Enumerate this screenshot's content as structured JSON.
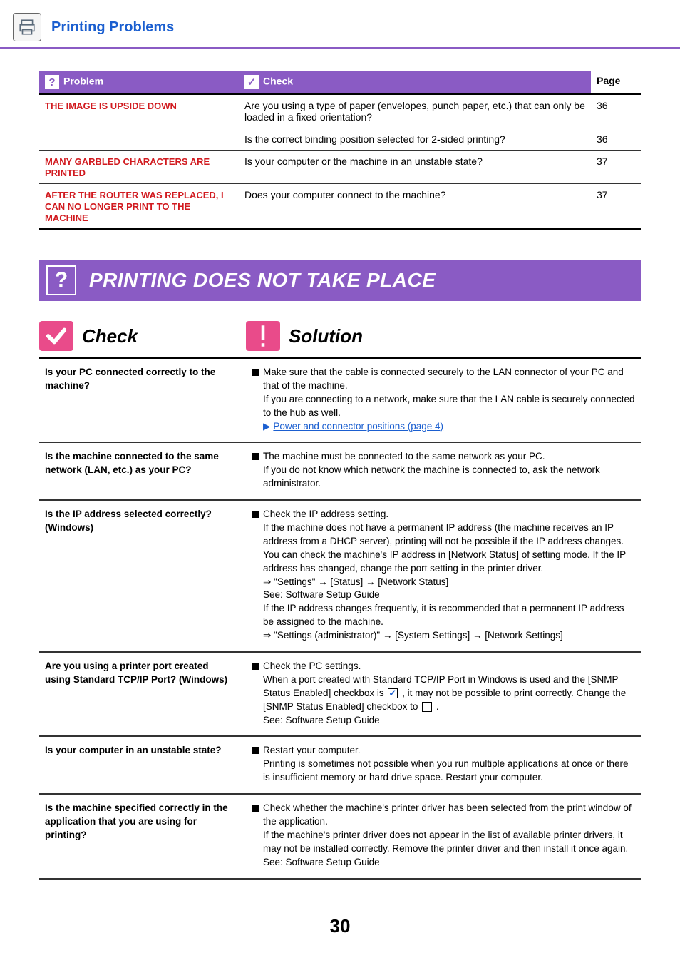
{
  "header": {
    "title": "Printing Problems"
  },
  "top_table": {
    "columns": {
      "problem": "Problem",
      "check": "Check",
      "page": "Page"
    },
    "rows": [
      {
        "problem": "THE IMAGE IS UPSIDE DOWN",
        "check": "Are you using a type of paper (envelopes, punch paper, etc.) that can only be loaded in a fixed orientation?",
        "page": "36",
        "rowspan": 2
      },
      {
        "problem": "",
        "check": "Is the correct binding position selected for 2-sided printing?",
        "page": "36"
      },
      {
        "problem": "MANY GARBLED CHARACTERS ARE PRINTED",
        "check": "Is your computer or the machine in an unstable state?",
        "page": "37"
      },
      {
        "problem": "AFTER THE ROUTER WAS REPLACED, I CAN NO LONGER PRINT TO THE MACHINE",
        "check": "Does your computer connect to the machine?",
        "page": "37"
      }
    ]
  },
  "banner": {
    "title": "PRINTING DOES NOT TAKE PLACE"
  },
  "cs_header": {
    "check": "Check",
    "solution": "Solution"
  },
  "solutions": [
    {
      "check": "Is your PC connected correctly to the machine?",
      "lead": "Make sure that the cable is connected securely to the LAN connector of your PC and that of the machine.",
      "rest": "If you are connecting to a network, make sure that the LAN cable is securely connected to the hub as well.",
      "link": "Power and connector positions (page 4)"
    },
    {
      "check": "Is the machine connected to the same network (LAN, etc.) as your PC?",
      "lead": "The machine must be connected to the same network as your PC.",
      "rest": "If you do not know which network the machine is connected to, ask the network administrator."
    },
    {
      "check": "Is the IP address selected correctly? (Windows)",
      "lead": "Check the IP address setting.",
      "rest_lines": [
        "If the machine does not have a permanent IP address (the machine receives an IP address from a DHCP server), printing will not be possible if the IP address changes.",
        "You can check the machine's IP address in [Network Status] of setting mode. If the IP address has changed, change the port setting in the printer driver.",
        "⇒ \"Settings\" → [Status] → [Network Status]",
        "See: Software Setup Guide",
        "If the IP address changes frequently, it is recommended that a permanent IP address be assigned to the machine.",
        "⇒ \"Settings (administrator)\" → [System Settings] → [Network Settings]"
      ]
    },
    {
      "check": "Are you using a printer port created using Standard TCP/IP Port? (Windows)",
      "lead": "Check the PC settings.",
      "snmp_pre": "When a port created with Standard TCP/IP Port in Windows is used and the [SNMP Status Enabled] checkbox is ",
      "snmp_mid": " , it may not be possible to print correctly. Change the [SNMP Status Enabled] checkbox to ",
      "snmp_post": " .",
      "rest2": "See: Software Setup Guide"
    },
    {
      "check": "Is your computer in an unstable state?",
      "lead": "Restart your computer.",
      "rest": "Printing is sometimes not possible when you run multiple applications at once or there is insufficient memory or hard drive space. Restart your computer."
    },
    {
      "check": "Is the machine specified correctly in the application that you are using for printing?",
      "lead": "Check whether the machine's printer driver has been selected from the print window of the application.",
      "rest_lines": [
        "If the machine's printer driver does not appear in the list of available printer drivers, it may not be installed correctly.  Remove the printer driver and then install it once again.",
        "See: Software Setup Guide"
      ]
    }
  ],
  "page_number": "30"
}
